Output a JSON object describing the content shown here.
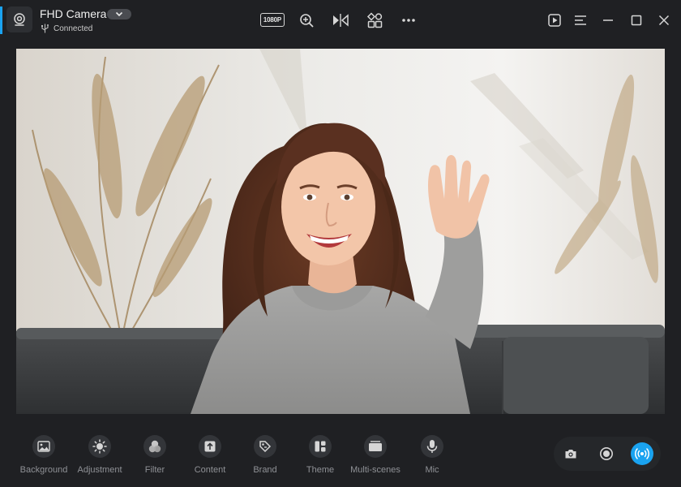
{
  "header": {
    "camera_name": "FHD Camera",
    "status": "Connected",
    "resolution": "1080P"
  },
  "icons": {
    "app": "webcam-icon",
    "dropdown": "chevron-down-icon",
    "usb": "usb-icon",
    "zoom": "zoom-in-icon",
    "mirror": "mirror-icon",
    "widgets": "widgets-icon",
    "more": "more-icon",
    "gallery": "media-play-icon",
    "menu": "menu-icon",
    "minimize": "minimize-icon",
    "maximize": "maximize-icon",
    "close": "close-icon"
  },
  "toolbar": {
    "items": [
      {
        "label": "Background",
        "icon": "image-icon"
      },
      {
        "label": "Adjustment",
        "icon": "brightness-icon"
      },
      {
        "label": "Filter",
        "icon": "filter-icon"
      },
      {
        "label": "Content",
        "icon": "upload-icon"
      },
      {
        "label": "Brand",
        "icon": "tag-icon"
      },
      {
        "label": "Theme",
        "icon": "theme-icon"
      },
      {
        "label": "Multi-scenes",
        "icon": "scenes-icon"
      },
      {
        "label": "Mic",
        "icon": "microphone-icon"
      }
    ]
  },
  "capture": {
    "photo": "camera-icon",
    "record": "record-icon",
    "live": "live-broadcast-icon"
  },
  "colors": {
    "background": "#1f2023",
    "accent": "#1aa3f0",
    "toolbar_label": "#8f9196",
    "icon_circle": "#333539"
  }
}
